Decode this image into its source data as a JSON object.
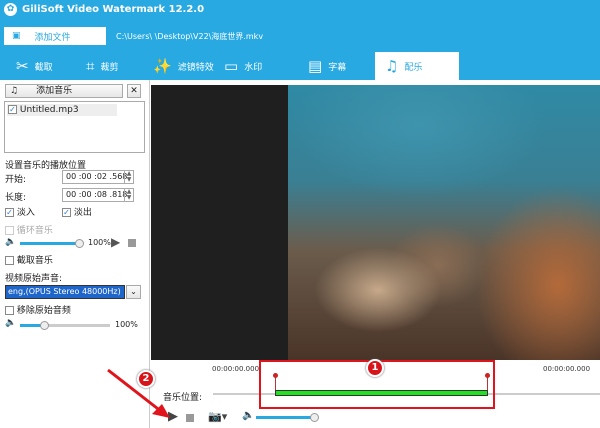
{
  "app": {
    "title": "GiliSoft Video Watermark 12.2.0"
  },
  "toolbar": {
    "add_file": "添加文件",
    "file_path": "C:\\Users\\          \\Desktop\\V22\\海底世界.mkv"
  },
  "tabs": [
    {
      "label": "截取",
      "icon": "scissors-icon"
    },
    {
      "label": "裁剪",
      "icon": "crop-icon"
    },
    {
      "label": "滤镜特效",
      "icon": "magic-wand-icon"
    },
    {
      "label": "水印",
      "icon": "watermark-icon"
    },
    {
      "label": "字幕",
      "icon": "subtitle-icon"
    },
    {
      "label": "配乐",
      "icon": "music-icon",
      "active": true
    }
  ],
  "music": {
    "add_music": "添加音乐",
    "files": [
      {
        "name": "Untitled.mp3",
        "checked": true
      }
    ],
    "position_heading": "设置音乐的播放位置",
    "start_label": "开始:",
    "start_value": "00 :00 :02 .568",
    "length_label": "长度:",
    "length_value": "00 :00 :08 .818",
    "fade_in": "淡入",
    "fade_out": "淡出",
    "loop": "循环音乐",
    "volume": "100%",
    "volume_fraction": 1.0,
    "trim": "截取音乐"
  },
  "original_audio": {
    "heading": "视频原始声音:",
    "track": "eng,(OPUS Stereo 48000Hz)",
    "remove": "移除原始音频",
    "volume": "100%",
    "volume_fraction": 0.25
  },
  "timeline": {
    "start_time": "00:00:00.000",
    "end_time": "00:00:00.000",
    "label": "音乐位置:",
    "player_volume_fraction": 0.95
  },
  "annotations": {
    "badge1": "1",
    "badge2": "2"
  }
}
